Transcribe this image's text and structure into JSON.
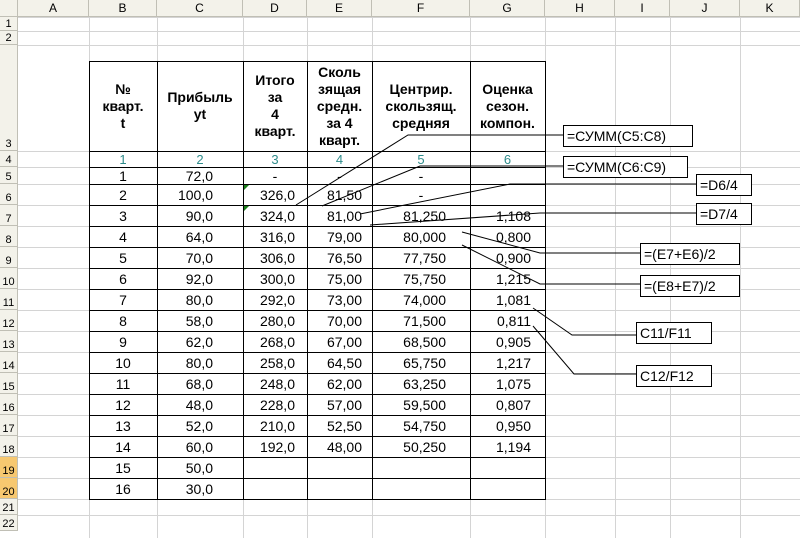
{
  "columns": [
    "A",
    "B",
    "C",
    "D",
    "E",
    "F",
    "G",
    "H",
    "I",
    "J",
    "K"
  ],
  "rows": [
    "1",
    "2",
    "3",
    "4",
    "5",
    "6",
    "7",
    "8",
    "9",
    "10",
    "11",
    "12",
    "13",
    "14",
    "15",
    "16",
    "17",
    "18",
    "19",
    "20",
    "21",
    "22"
  ],
  "selected_rows": [
    "19",
    "20"
  ],
  "table": {
    "headers": [
      [
        "№",
        "кварт.",
        "t"
      ],
      [
        "Прибыль",
        "yt"
      ],
      [
        "Итого",
        "за",
        "4",
        "кварт."
      ],
      [
        "Сколь",
        "зящая",
        "средн.",
        "за 4",
        "кварт."
      ],
      [
        "Центрир.",
        "скользящ.",
        "средняя"
      ],
      [
        "Оценка",
        "сезон.",
        "компон."
      ]
    ],
    "index_row": [
      "1",
      "2",
      "3",
      "4",
      "5",
      "6"
    ],
    "data": [
      [
        "1",
        "72,0",
        "-",
        "-",
        "-",
        ""
      ],
      [
        "2",
        "100,0",
        "326,0",
        "81,50",
        "-",
        ""
      ],
      [
        "3",
        "90,0",
        "324,0",
        "81,00",
        "81,250",
        "1,108"
      ],
      [
        "4",
        "64,0",
        "316,0",
        "79,00",
        "80,000",
        "0,800"
      ],
      [
        "5",
        "70,0",
        "306,0",
        "76,50",
        "77,750",
        "0,900"
      ],
      [
        "6",
        "92,0",
        "300,0",
        "75,00",
        "75,750",
        "1,215"
      ],
      [
        "7",
        "80,0",
        "292,0",
        "73,00",
        "74,000",
        "1,081"
      ],
      [
        "8",
        "58,0",
        "280,0",
        "70,00",
        "71,500",
        "0,811"
      ],
      [
        "9",
        "62,0",
        "268,0",
        "67,00",
        "68,500",
        "0,905"
      ],
      [
        "10",
        "80,0",
        "258,0",
        "64,50",
        "65,750",
        "1,217"
      ],
      [
        "11",
        "68,0",
        "248,0",
        "62,00",
        "63,250",
        "1,075"
      ],
      [
        "12",
        "48,0",
        "228,0",
        "57,00",
        "59,500",
        "0,807"
      ],
      [
        "13",
        "52,0",
        "210,0",
        "52,50",
        "54,750",
        "0,950"
      ],
      [
        "14",
        "60,0",
        "192,0",
        "48,00",
        "50,250",
        "1,194"
      ],
      [
        "15",
        "50,0",
        "",
        "",
        "",
        ""
      ],
      [
        "16",
        "30,0",
        "",
        "",
        "",
        ""
      ]
    ]
  },
  "callouts": [
    {
      "name": "callout-sum-c5-c8",
      "text": "=СУММ(C5:C8)"
    },
    {
      "name": "callout-sum-c6-c9",
      "text": "=СУММ(C6:C9)"
    },
    {
      "name": "callout-d6",
      "text": "=D6/4"
    },
    {
      "name": "callout-d7",
      "text": "=D7/4"
    },
    {
      "name": "callout-e7-e6",
      "text": "=(E7+E6)/2"
    },
    {
      "name": "callout-e8-e7",
      "text": "=(E8+E7)/2"
    },
    {
      "name": "callout-c11-f11",
      "text": "C11/F11"
    },
    {
      "name": "callout-c12-f12",
      "text": "C12/F12"
    }
  ],
  "colors": {
    "header_bg": "#f3f2ea",
    "selected_row_header": "#f7c870",
    "index_text": "#2e8b8b",
    "error_marker": "#1a7f1a"
  }
}
